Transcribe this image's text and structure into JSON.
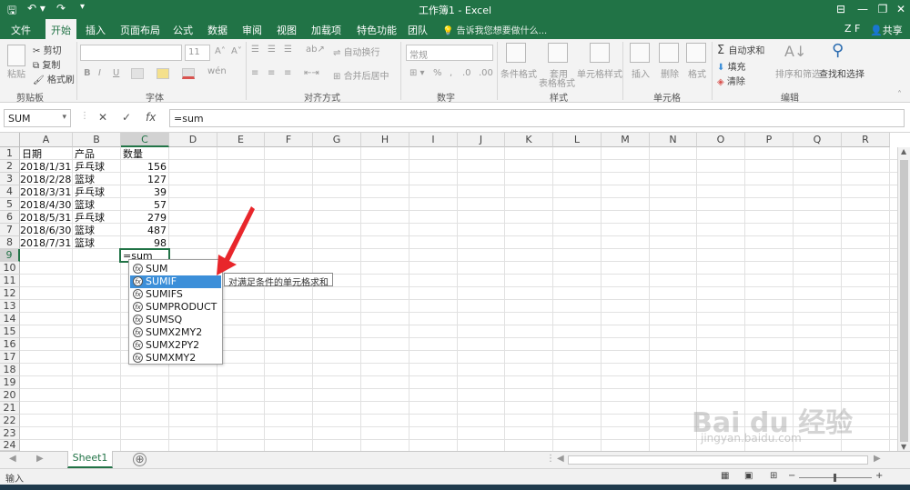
{
  "window": {
    "title": "工作簿1 - Excel"
  },
  "tabs": [
    {
      "label": "文件"
    },
    {
      "label": "开始"
    },
    {
      "label": "插入"
    },
    {
      "label": "页面布局"
    },
    {
      "label": "公式"
    },
    {
      "label": "数据"
    },
    {
      "label": "审阅"
    },
    {
      "label": "视图"
    },
    {
      "label": "加载项"
    },
    {
      "label": "特色功能"
    },
    {
      "label": "团队"
    }
  ],
  "tell_me": "告诉我您想要做什么...",
  "user": {
    "name": "Z F",
    "share": "共享"
  },
  "ribbon": {
    "clipboard": {
      "paste": "粘贴",
      "cut": "剪切",
      "copy": "复制",
      "format_painter": "格式刷",
      "group": "剪贴板"
    },
    "font": {
      "size": "11",
      "group": "字体",
      "bold": "B",
      "italic": "I",
      "underline": "U"
    },
    "alignment": {
      "wrap": "自动换行",
      "merge": "合并后居中",
      "group": "对齐方式"
    },
    "number": {
      "format": "常规",
      "percent": "%",
      "group": "数字"
    },
    "styles": {
      "conditional": "条件格式",
      "table_a": "套用",
      "table_b": "表格格式",
      "cell_styles": "单元格样式",
      "group": "样式"
    },
    "cells": {
      "insert": "插入",
      "delete": "删除",
      "format": "格式",
      "group": "单元格"
    },
    "editing": {
      "autosum": "自动求和",
      "fill": "填充",
      "clear": "清除",
      "sort": "排序和筛选",
      "find": "查找和选择",
      "group": "编辑"
    }
  },
  "formula_bar": {
    "name_box": "SUM",
    "cancel": "✕",
    "enter": "✓",
    "fx": "fx",
    "formula": "=sum"
  },
  "columns": [
    "A",
    "B",
    "C",
    "D",
    "E",
    "F",
    "G",
    "H",
    "I",
    "J",
    "K",
    "L",
    "M",
    "N",
    "O",
    "P",
    "Q",
    "R"
  ],
  "rows": [
    "1",
    "2",
    "3",
    "4",
    "5",
    "6",
    "7",
    "8",
    "9",
    "10",
    "11",
    "12",
    "13",
    "14",
    "15",
    "16",
    "17",
    "18",
    "19",
    "20",
    "21",
    "22",
    "23",
    "24"
  ],
  "table": {
    "headers": [
      "日期",
      "产品",
      "数量"
    ],
    "records": [
      {
        "date": "2018/1/31",
        "product": "乒乓球",
        "qty": "156"
      },
      {
        "date": "2018/2/28",
        "product": "篮球",
        "qty": "127"
      },
      {
        "date": "2018/3/31",
        "product": "乒乓球",
        "qty": "39"
      },
      {
        "date": "2018/4/30",
        "product": "篮球",
        "qty": "57"
      },
      {
        "date": "2018/5/31",
        "product": "乒乓球",
        "qty": "279"
      },
      {
        "date": "2018/6/30",
        "product": "篮球",
        "qty": "487"
      },
      {
        "date": "2018/7/31",
        "product": "篮球",
        "qty": "98"
      }
    ],
    "editing_value": "=sum"
  },
  "autocomplete": {
    "items": [
      "SUM",
      "SUMIF",
      "SUMIFS",
      "SUMPRODUCT",
      "SUMSQ",
      "SUMX2MY2",
      "SUMX2PY2",
      "SUMXMY2"
    ],
    "selected": "SUMIF",
    "tooltip": "对满足条件的单元格求和"
  },
  "sheets": [
    {
      "name": "Sheet1"
    }
  ],
  "add_sheet": "⊕",
  "status": {
    "mode": "输入",
    "zoom_minus": "−",
    "zoom_plus": "+",
    "zoom_level": ""
  },
  "colors": {
    "excel_green": "#217346",
    "selection_blue": "#3c8fd9",
    "arrow_red": "#e8262b"
  },
  "watermark": {
    "brand": "Bai du 经验",
    "url": "jingyan.baidu.com"
  }
}
